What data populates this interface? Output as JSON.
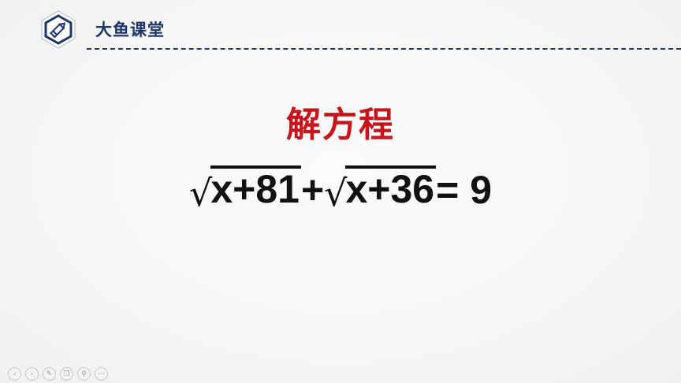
{
  "header": {
    "brand": "大鱼课堂",
    "logo_icon": "pencil-hexagon-icon"
  },
  "slide": {
    "title": "解方程",
    "equation": {
      "root1": "x+81",
      "plus": "+",
      "root2": "x+36",
      "equals": "=",
      "rhs": "9"
    }
  },
  "controls": [
    {
      "name": "prev-slide-icon",
      "glyph": "‹"
    },
    {
      "name": "next-slide-icon",
      "glyph": "›"
    },
    {
      "name": "pen-tool-icon",
      "glyph": "✎"
    },
    {
      "name": "slides-view-icon",
      "glyph": "❐"
    },
    {
      "name": "zoom-icon",
      "glyph": "⚲"
    },
    {
      "name": "more-options-icon",
      "glyph": "···"
    }
  ],
  "colors": {
    "brand": "#1e3567",
    "title": "#c8141b",
    "equation": "#111111"
  }
}
